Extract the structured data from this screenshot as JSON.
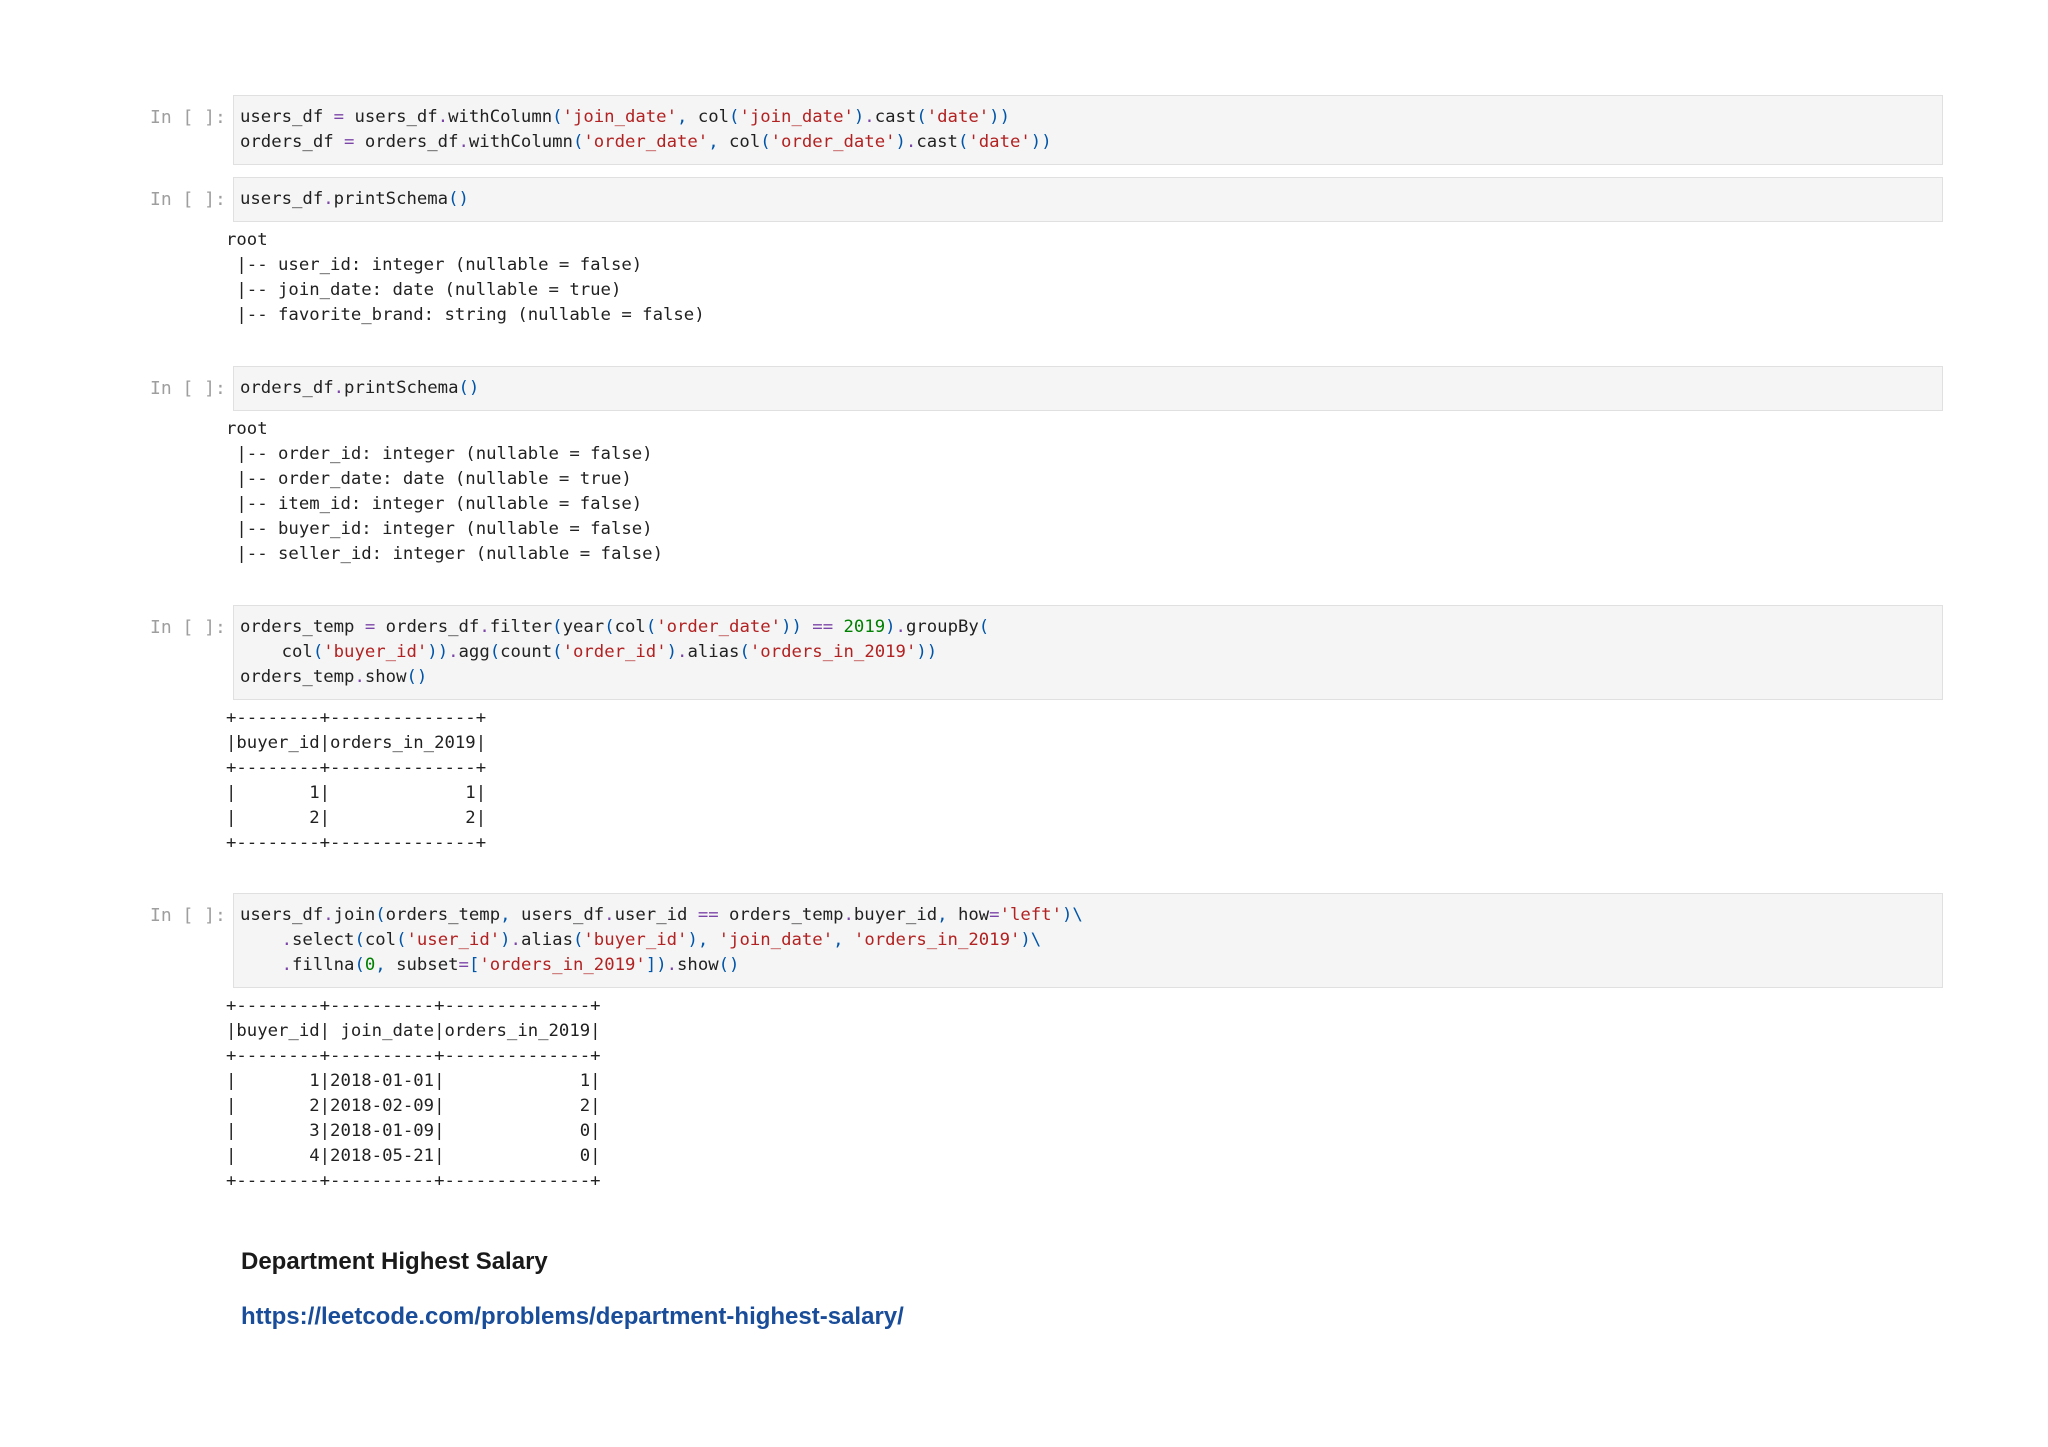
{
  "cells": [
    {
      "prompt": "In [ ]:",
      "code": [
        [
          [
            "users_df ",
            ""
          ],
          [
            "=",
            "o"
          ],
          [
            " users_df",
            ""
          ],
          [
            ".",
            "o"
          ],
          [
            "withColumn",
            ""
          ],
          [
            "(",
            "p"
          ],
          [
            "'join_date'",
            "s"
          ],
          [
            ", ",
            "p"
          ],
          [
            "col",
            ""
          ],
          [
            "(",
            "p"
          ],
          [
            "'join_date'",
            "s"
          ],
          [
            ")",
            "p"
          ],
          [
            ".",
            "o"
          ],
          [
            "cast",
            ""
          ],
          [
            "(",
            "p"
          ],
          [
            "'date'",
            "s"
          ],
          [
            "))",
            "p"
          ]
        ],
        [
          [
            "orders_df ",
            ""
          ],
          [
            "=",
            "o"
          ],
          [
            " orders_df",
            ""
          ],
          [
            ".",
            "o"
          ],
          [
            "withColumn",
            ""
          ],
          [
            "(",
            "p"
          ],
          [
            "'order_date'",
            "s"
          ],
          [
            ", ",
            "p"
          ],
          [
            "col",
            ""
          ],
          [
            "(",
            "p"
          ],
          [
            "'order_date'",
            "s"
          ],
          [
            ")",
            "p"
          ],
          [
            ".",
            "o"
          ],
          [
            "cast",
            ""
          ],
          [
            "(",
            "p"
          ],
          [
            "'date'",
            "s"
          ],
          [
            "))",
            "p"
          ]
        ]
      ],
      "output": []
    },
    {
      "prompt": "In [ ]:",
      "code": [
        [
          [
            "users_df",
            ""
          ],
          [
            ".",
            "o"
          ],
          [
            "printSchema",
            ""
          ],
          [
            "()",
            "p"
          ]
        ]
      ],
      "output": [
        "root",
        " |-- user_id: integer (nullable = false)",
        " |-- join_date: date (nullable = true)",
        " |-- favorite_brand: string (nullable = false)"
      ]
    },
    {
      "prompt": "In [ ]:",
      "code": [
        [
          [
            "orders_df",
            ""
          ],
          [
            ".",
            "o"
          ],
          [
            "printSchema",
            ""
          ],
          [
            "()",
            "p"
          ]
        ]
      ],
      "output": [
        "root",
        " |-- order_id: integer (nullable = false)",
        " |-- order_date: date (nullable = true)",
        " |-- item_id: integer (nullable = false)",
        " |-- buyer_id: integer (nullable = false)",
        " |-- seller_id: integer (nullable = false)"
      ]
    },
    {
      "prompt": "In [ ]:",
      "code": [
        [
          [
            "orders_temp ",
            ""
          ],
          [
            "=",
            "o"
          ],
          [
            " orders_df",
            ""
          ],
          [
            ".",
            "o"
          ],
          [
            "filter",
            ""
          ],
          [
            "(",
            "p"
          ],
          [
            "year",
            ""
          ],
          [
            "(",
            "p"
          ],
          [
            "col",
            ""
          ],
          [
            "(",
            "p"
          ],
          [
            "'order_date'",
            "s"
          ],
          [
            "))",
            "p"
          ],
          [
            " ",
            ""
          ],
          [
            "==",
            "o"
          ],
          [
            " ",
            ""
          ],
          [
            "2019",
            "n"
          ],
          [
            ")",
            "p"
          ],
          [
            ".",
            "o"
          ],
          [
            "groupBy",
            ""
          ],
          [
            "(",
            "p"
          ]
        ],
        [
          [
            "    col",
            ""
          ],
          [
            "(",
            "p"
          ],
          [
            "'buyer_id'",
            "s"
          ],
          [
            "))",
            "p"
          ],
          [
            ".",
            "o"
          ],
          [
            "agg",
            ""
          ],
          [
            "(",
            "p"
          ],
          [
            "count",
            ""
          ],
          [
            "(",
            "p"
          ],
          [
            "'order_id'",
            "s"
          ],
          [
            ")",
            "p"
          ],
          [
            ".",
            "o"
          ],
          [
            "alias",
            ""
          ],
          [
            "(",
            "p"
          ],
          [
            "'orders_in_2019'",
            "s"
          ],
          [
            "))",
            "p"
          ]
        ],
        [
          [
            "orders_temp",
            ""
          ],
          [
            ".",
            "o"
          ],
          [
            "show",
            ""
          ],
          [
            "()",
            "p"
          ]
        ]
      ],
      "output": [
        "+--------+--------------+",
        "|buyer_id|orders_in_2019|",
        "+--------+--------------+",
        "|       1|             1|",
        "|       2|             2|",
        "+--------+--------------+"
      ]
    },
    {
      "prompt": "In [ ]:",
      "code": [
        [
          [
            "users_df",
            ""
          ],
          [
            ".",
            "o"
          ],
          [
            "join",
            ""
          ],
          [
            "(",
            "p"
          ],
          [
            "orders_temp",
            ""
          ],
          [
            ", ",
            "p"
          ],
          [
            "users_df",
            ""
          ],
          [
            ".",
            "o"
          ],
          [
            "user_id ",
            ""
          ],
          [
            "==",
            "o"
          ],
          [
            " orders_temp",
            ""
          ],
          [
            ".",
            "o"
          ],
          [
            "buyer_id",
            ""
          ],
          [
            ", ",
            "p"
          ],
          [
            "how",
            ""
          ],
          [
            "=",
            "o"
          ],
          [
            "'left'",
            "s"
          ],
          [
            ")\\",
            "p"
          ]
        ],
        [
          [
            "    ",
            ""
          ],
          [
            ".",
            "o"
          ],
          [
            "select",
            ""
          ],
          [
            "(",
            "p"
          ],
          [
            "col",
            ""
          ],
          [
            "(",
            "p"
          ],
          [
            "'user_id'",
            "s"
          ],
          [
            ")",
            "p"
          ],
          [
            ".",
            "o"
          ],
          [
            "alias",
            ""
          ],
          [
            "(",
            "p"
          ],
          [
            "'buyer_id'",
            "s"
          ],
          [
            "), ",
            "p"
          ],
          [
            "'join_date'",
            "s"
          ],
          [
            ", ",
            "p"
          ],
          [
            "'orders_in_2019'",
            "s"
          ],
          [
            ")\\",
            "p"
          ]
        ],
        [
          [
            "    ",
            ""
          ],
          [
            ".",
            "o"
          ],
          [
            "fillna",
            ""
          ],
          [
            "(",
            "p"
          ],
          [
            "0",
            "n"
          ],
          [
            ", ",
            "p"
          ],
          [
            "subset",
            ""
          ],
          [
            "=",
            "o"
          ],
          [
            "[",
            "p"
          ],
          [
            "'orders_in_2019'",
            "s"
          ],
          [
            "])",
            "p"
          ],
          [
            ".",
            "o"
          ],
          [
            "show",
            ""
          ],
          [
            "()",
            "p"
          ]
        ]
      ],
      "output": [
        "+--------+----------+--------------+",
        "|buyer_id| join_date|orders_in_2019|",
        "+--------+----------+--------------+",
        "|       1|2018-01-01|             1|",
        "|       2|2018-02-09|             2|",
        "|       3|2018-01-09|             0|",
        "|       4|2018-05-21|             0|",
        "+--------+----------+--------------+"
      ]
    }
  ],
  "markdown": {
    "heading": "Department Highest Salary",
    "link_text": "https://leetcode.com/problems/department-highest-salary/"
  }
}
